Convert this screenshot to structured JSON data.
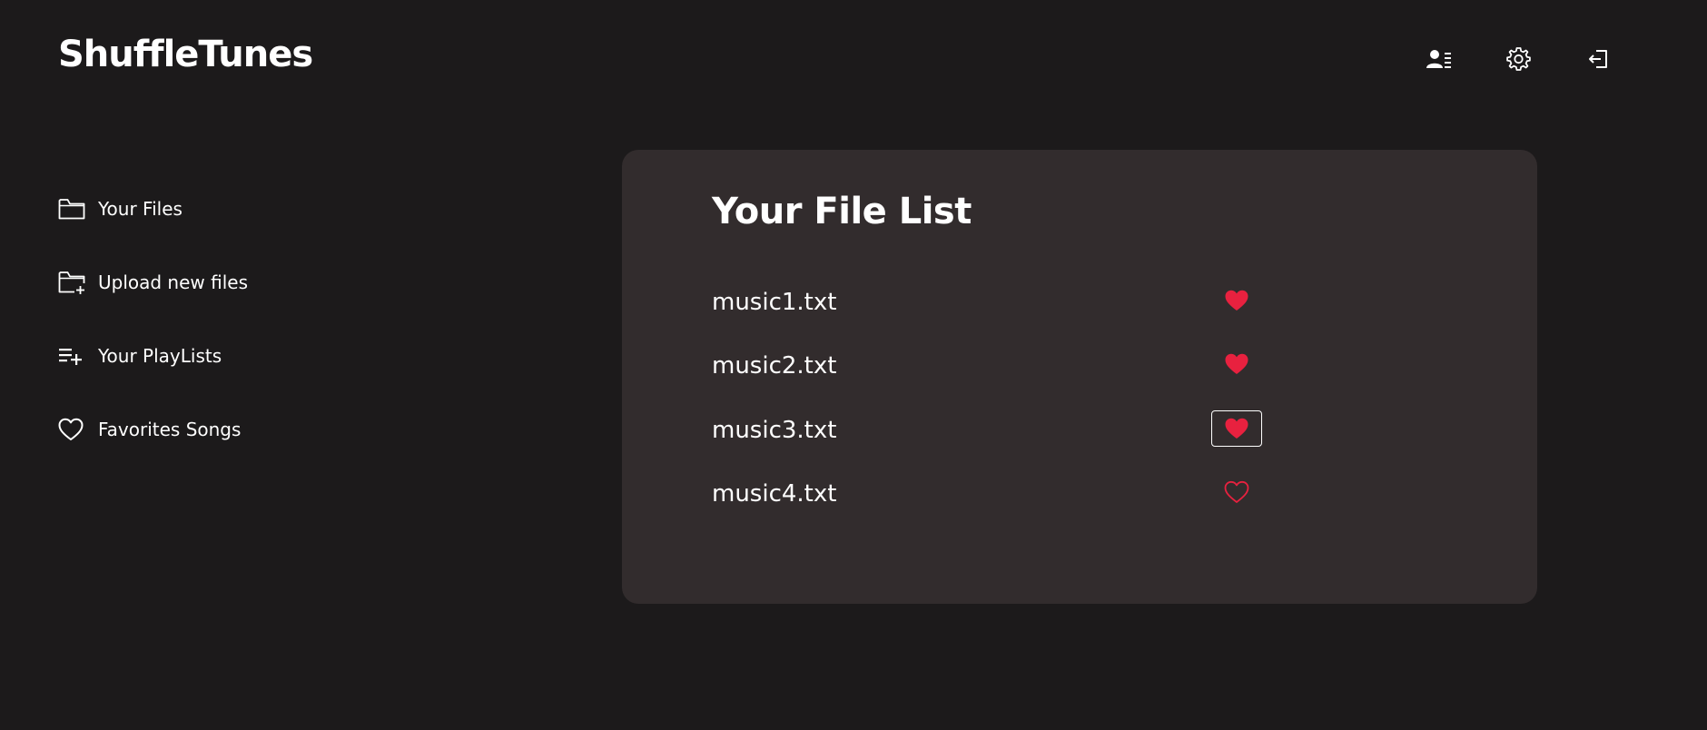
{
  "header": {
    "brand": "ShuffleTunes",
    "actions": [
      {
        "icon": "profile-list-icon"
      },
      {
        "icon": "gear-icon"
      },
      {
        "icon": "sign-out-icon"
      }
    ]
  },
  "sidebar": {
    "items": [
      {
        "label": "Your Files",
        "icon": "folder-icon"
      },
      {
        "label": "Upload new files",
        "icon": "folder-add-icon"
      },
      {
        "label": "Your PlayLists",
        "icon": "playlist-add-icon"
      },
      {
        "label": "Favorites Songs",
        "icon": "heart-outline-icon"
      }
    ]
  },
  "main": {
    "title": "Your File List",
    "files": [
      {
        "name": "music1.txt",
        "favorite": true
      },
      {
        "name": "music2.txt",
        "favorite": true
      },
      {
        "name": "music3.txt",
        "favorite": true,
        "focused": true
      },
      {
        "name": "music4.txt",
        "favorite": false
      }
    ]
  },
  "colors": {
    "background": "#1c1a1b",
    "card": "#322c2d",
    "heart": "#e8213f",
    "text": "#ffffff"
  }
}
